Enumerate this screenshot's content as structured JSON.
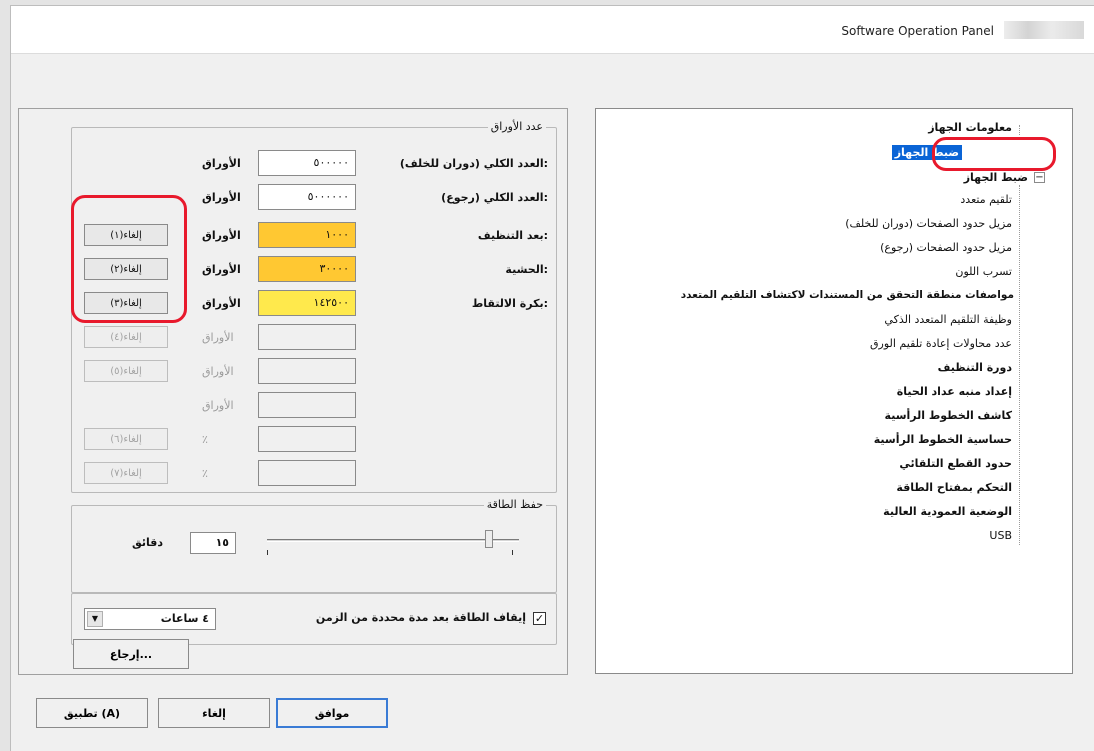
{
  "window": {
    "title": "Software Operation Panel"
  },
  "counters": {
    "group_title": "عدد الأوراق",
    "rows": [
      {
        "label": "العدد الكلي (دوران للخلف):",
        "value": "٥٠٠٠٠٠",
        "unit": "الأوراق",
        "button": ""
      },
      {
        "label": "العدد الكلي (رجوع):",
        "value": "٥٠٠٠٠٠٠",
        "unit": "الأوراق",
        "button": ""
      },
      {
        "label": "بعد التنظيف:",
        "value": "١٠٠٠",
        "unit": "الأوراق",
        "button": "إلغاء(١)"
      },
      {
        "label": "الحشية:",
        "value": "٣٠٠٠٠",
        "unit": "الأوراق",
        "button": "إلغاء(٢)"
      },
      {
        "label": "بكرة الالتقاط:",
        "value": "١٤٢٥٠٠",
        "unit": "الأوراق",
        "button": "إلغاء(٣)"
      },
      {
        "label": "",
        "value": "",
        "unit": "الأوراق",
        "button": "إلغاء(٤)"
      },
      {
        "label": "",
        "value": "",
        "unit": "الأوراق",
        "button": "إلغاء(٥)"
      },
      {
        "label": "",
        "value": "",
        "unit": "الأوراق",
        "button": ""
      },
      {
        "label": "",
        "value": "",
        "unit": "٪",
        "button": "إلغاء(٦)"
      },
      {
        "label": "",
        "value": "",
        "unit": "٪",
        "button": "إلغاء(٧)"
      }
    ]
  },
  "power_saving": {
    "group_title": "حفظ الطاقة",
    "minutes_value": "١٥",
    "minutes_label": "دقائق",
    "slider_level": 0.88
  },
  "auto_off": {
    "checked": true,
    "label": "إيقاف الطاقة بعد مدة محددة من الزمن",
    "dropdown_value": "٤ ساعات"
  },
  "reset_button": "إرجاع...",
  "tree": {
    "items": [
      {
        "label": "معلومات الجهاز",
        "selected": false
      },
      {
        "label": "ضبط الجهاز",
        "selected": true
      },
      {
        "label": "ضبط الجهاز",
        "selected": false
      },
      {
        "label": "تلقيم متعدد",
        "selected": false
      },
      {
        "label": "مزيل حدود الصفحات (دوران للخلف)",
        "selected": false
      },
      {
        "label": "مزيل حدود الصفحات (رجوع)",
        "selected": false
      },
      {
        "label": "تسرب اللون",
        "selected": false
      },
      {
        "label": "مواصفات منطقة التحقق من المستندات لاكتشاف التلقيم المتعدد",
        "selected": false
      },
      {
        "label": "وظيفة التلقيم المتعدد الذكي",
        "selected": false
      },
      {
        "label": "عدد محاولات إعادة تلقيم الورق",
        "selected": false
      },
      {
        "label": "دورة التنظيف",
        "selected": false
      },
      {
        "label": "إعداد منبه عداد الحياة",
        "selected": false
      },
      {
        "label": "كاشف الخطوط الرأسية",
        "selected": false
      },
      {
        "label": "حساسية الخطوط الرأسية",
        "selected": false
      },
      {
        "label": "حدود القطع التلقائي",
        "selected": false
      },
      {
        "label": "التحكم بمفتاح الطاقة",
        "selected": false
      },
      {
        "label": "الوضعية العمودية العالية",
        "selected": false
      },
      {
        "label": "USB",
        "selected": false
      }
    ]
  },
  "dialog_buttons": {
    "ok": "موافق",
    "cancel": "إلغاء",
    "apply": "تطبيق (A)"
  },
  "colors": {
    "highlight_ring": "#e8192c",
    "selection": "#0a64d6",
    "counter_orange": "#ffc832",
    "counter_yellow": "#ffe94c"
  }
}
